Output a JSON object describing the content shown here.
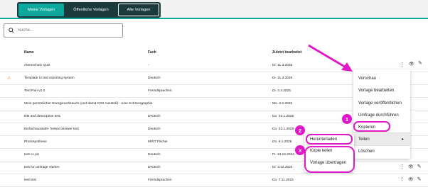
{
  "tabs": [
    "Meine Vorlagen",
    "Öffentliche Vorlagen",
    "Alte Vorlagen"
  ],
  "search": {
    "placeholder": "Suche..."
  },
  "columns": {
    "name": "Name",
    "subject": "Fach",
    "last_edited": "Zuletzt bearbeitet"
  },
  "rows": [
    {
      "name": "Atemschutz Quiz",
      "subject": "-",
      "date": "Di. 11.3.2025"
    },
    {
      "name": "Template to test reporting system",
      "subject": "Deutsch",
      "date": "Di. 11.3.2025",
      "warning": "⚠"
    },
    {
      "name": "Test Run v2.0",
      "subject": "Fremdsprachen",
      "date": "Di. 4.3.2025"
    },
    {
      "name": "Mein persönlicher Energieverbrauch (und damit CO2 Ausstoß) - eine SchGeographie",
      "subject": "",
      "date": "Mo. 3.2.2025"
    },
    {
      "name": "title and description test",
      "subject": "Deutsch",
      "date": "Do. 23.1.2025"
    },
    {
      "name": "Einfachauswahl- freitext answer test",
      "subject": "Deutsch",
      "date": "Do. 23.1.2025"
    },
    {
      "name": "Photosynthese",
      "subject": "MINT Fächer",
      "date": "Do. 9.1.2025"
    },
    {
      "name": "test cc pic",
      "subject": "Deutsch",
      "date": "Fr. 13.12.2024"
    },
    {
      "name": "test for umfrage starten",
      "subject": "Deutsch",
      "date": "Di. 3.12.2024"
    },
    {
      "name": "test test",
      "subject": "Fremdsprachen",
      "date": "Do. 7.11.2024"
    }
  ],
  "row_actions": {
    "more": "⋮",
    "view": "👁",
    "edit": "✎"
  },
  "context_menu": {
    "items": [
      "Vorschau",
      "Vorlage bearbeiten",
      "Vorlage veröffentlichen",
      "Umfrage durchführen",
      "Kopieren",
      "Teilen",
      "Löschen"
    ],
    "teilen_arrow": "▸"
  },
  "submenu": {
    "items": [
      "Herunterladen",
      "Kopie teilen",
      "Vorlage übertragen"
    ]
  },
  "badges": [
    "1",
    "2",
    "3"
  ],
  "colors": {
    "accent": "#0fa89c",
    "tabbar": "#1a3a3c",
    "highlight": "#e018c8",
    "warning": "#e8842c"
  }
}
